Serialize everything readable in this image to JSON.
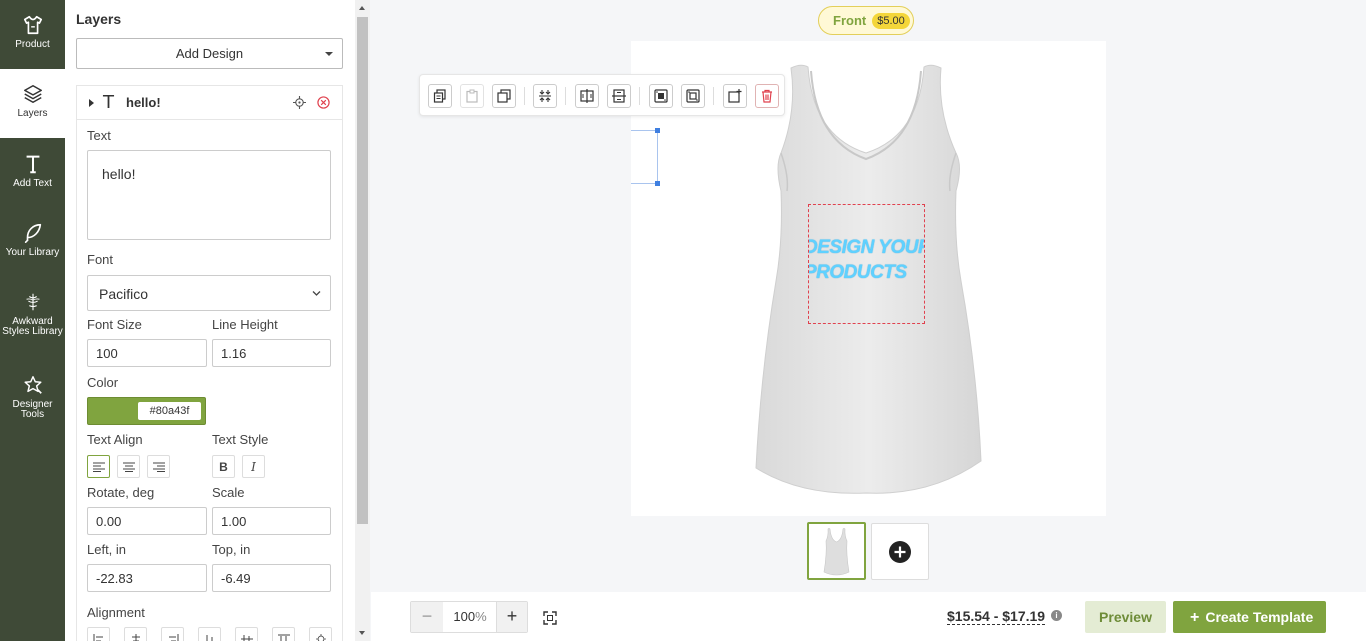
{
  "nav": {
    "items": [
      {
        "label": "Product",
        "icon": "tshirt-icon"
      },
      {
        "label": "Layers",
        "icon": "layers-icon"
      },
      {
        "label": "Add Text",
        "icon": "text-icon"
      },
      {
        "label": "Your Library",
        "icon": "feather-icon"
      },
      {
        "label": "Awkward Styles Library",
        "icon": "brand-logo-icon"
      },
      {
        "label": "Designer Tools",
        "icon": "designer-tools-icon"
      }
    ]
  },
  "panel": {
    "title": "Layers",
    "add_design_label": "Add Design",
    "layer": {
      "name": "hello!",
      "type_glyph": "T"
    },
    "fields": {
      "text_label": "Text",
      "text_value": "hello!",
      "font_label": "Font",
      "font_value": "Pacifico",
      "font_size_label": "Font Size",
      "font_size_value": "100",
      "line_height_label": "Line Height",
      "line_height_value": "1.16",
      "color_label": "Color",
      "color_value": "#80a43f",
      "text_align_label": "Text Align",
      "text_style_label": "Text Style",
      "bold_glyph": "B",
      "italic_glyph": "I",
      "rotate_label": "Rotate, deg",
      "rotate_value": "0.00",
      "scale_label": "Scale",
      "scale_value": "1.00",
      "left_label": "Left, in",
      "left_value": "-22.83",
      "top_label": "Top, in",
      "top_value": "-6.49",
      "alignment_label": "Alignment"
    }
  },
  "canvas": {
    "side_label": "Front",
    "side_price": "$5.00",
    "design_text_line1": "DESIGN YOUR",
    "design_text_line2": "PRODUCTS"
  },
  "bottom": {
    "zoom_minus": "−",
    "zoom_value": "100",
    "zoom_unit": "%",
    "zoom_plus": "+",
    "price_range": "$15.54 - $17.19",
    "info_glyph": "i",
    "preview_label": "Preview",
    "create_plus": "+",
    "create_label": "Create Template"
  },
  "colors": {
    "nav_bg": "#3f4a37",
    "accent": "#80a43f",
    "danger": "#e0414e",
    "design_text": "#5fd1ff"
  }
}
